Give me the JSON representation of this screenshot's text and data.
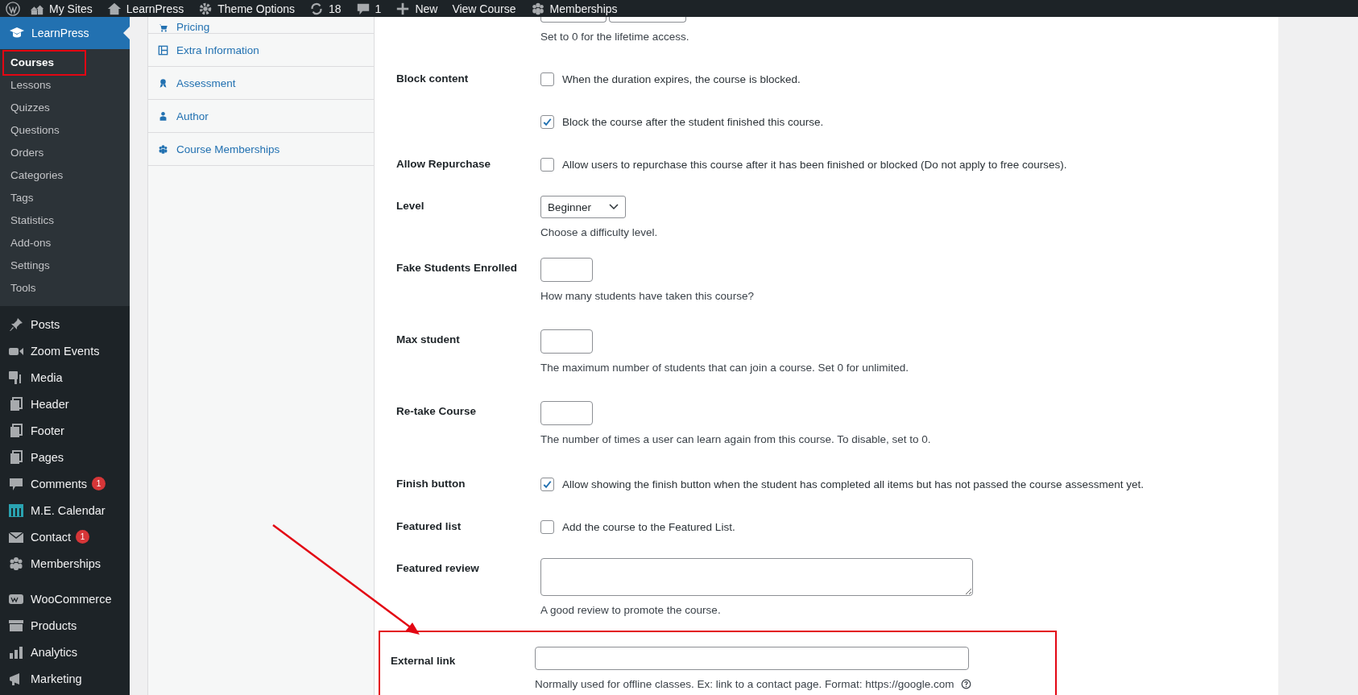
{
  "admin_bar": {
    "items": [
      {
        "label": "My Sites"
      },
      {
        "label": "LearnPress"
      },
      {
        "label": "Theme Options"
      },
      {
        "label": "18"
      },
      {
        "label": "1"
      },
      {
        "label": "New"
      },
      {
        "label": "View Course"
      },
      {
        "label": "Memberships"
      }
    ]
  },
  "sidebar": {
    "current": {
      "label": "LearnPress"
    },
    "submenu": [
      {
        "label": "Courses",
        "selected": true,
        "highlighted": true
      },
      {
        "label": "Lessons",
        "selected": false,
        "highlighted": false
      },
      {
        "label": "Quizzes",
        "selected": false,
        "highlighted": false
      },
      {
        "label": "Questions",
        "selected": false,
        "highlighted": false
      },
      {
        "label": "Orders",
        "selected": false,
        "highlighted": false
      },
      {
        "label": "Categories",
        "selected": false,
        "highlighted": false
      },
      {
        "label": "Tags",
        "selected": false,
        "highlighted": false
      },
      {
        "label": "Statistics",
        "selected": false,
        "highlighted": false
      },
      {
        "label": "Add-ons",
        "selected": false,
        "highlighted": false
      },
      {
        "label": "Settings",
        "selected": false,
        "highlighted": false
      },
      {
        "label": "Tools",
        "selected": false,
        "highlighted": false
      }
    ],
    "items": [
      {
        "label": "Posts"
      },
      {
        "label": "Zoom Events"
      },
      {
        "label": "Media"
      },
      {
        "label": "Header"
      },
      {
        "label": "Footer"
      },
      {
        "label": "Pages"
      },
      {
        "label": "Comments",
        "badge": "1"
      },
      {
        "label": "M.E. Calendar"
      },
      {
        "label": "Contact",
        "badge": "1"
      },
      {
        "label": "Memberships"
      },
      {
        "label": "WooCommerce"
      },
      {
        "label": "Products"
      },
      {
        "label": "Analytics"
      },
      {
        "label": "Marketing"
      }
    ]
  },
  "tabs": [
    {
      "label": "Pricing"
    },
    {
      "label": "Extra Information"
    },
    {
      "label": "Assessment"
    },
    {
      "label": "Author"
    },
    {
      "label": "Course Memberships"
    }
  ],
  "form": [
    {
      "kind": "duration",
      "hint": "Set to 0 for the lifetime access."
    },
    {
      "kind": "checkbox",
      "label": "Block content",
      "options": [
        {
          "label": "When the duration expires, the course is blocked.",
          "checked": false
        },
        {
          "label": "Block the course after the student finished this course.",
          "checked": true
        }
      ]
    },
    {
      "kind": "checkbox",
      "label": "Allow Repurchase",
      "options": [
        {
          "label": "Allow users to repurchase this course after it has been finished or blocked (Do not apply to free courses).",
          "checked": false
        }
      ]
    },
    {
      "kind": "select",
      "label": "Level",
      "value": "Beginner",
      "hint": "Choose a difficulty level."
    },
    {
      "kind": "number",
      "label": "Fake Students Enrolled",
      "hint": "How many students have taken this course?"
    },
    {
      "kind": "number",
      "label": "Max student",
      "hint": "The maximum number of students that can join a course. Set 0 for unlimited."
    },
    {
      "kind": "number",
      "label": "Re-take Course",
      "hint": "The number of times a user can learn again from this course. To disable, set to 0."
    },
    {
      "kind": "checkbox",
      "label": "Finish button",
      "options": [
        {
          "label": "Allow showing the finish button when the student has completed all items but has not passed the course assessment yet.",
          "checked": true
        }
      ]
    },
    {
      "kind": "checkbox",
      "label": "Featured list",
      "options": [
        {
          "label": "Add the course to the Featured List.",
          "checked": false
        }
      ]
    },
    {
      "kind": "textarea",
      "label": "Featured review",
      "hint": "A good review to promote the course."
    },
    {
      "kind": "text",
      "label": "External link",
      "hint": "Normally used for offline classes. Ex: link to a contact page. Format: https://google.com",
      "help": true,
      "highlighted": true
    }
  ]
}
